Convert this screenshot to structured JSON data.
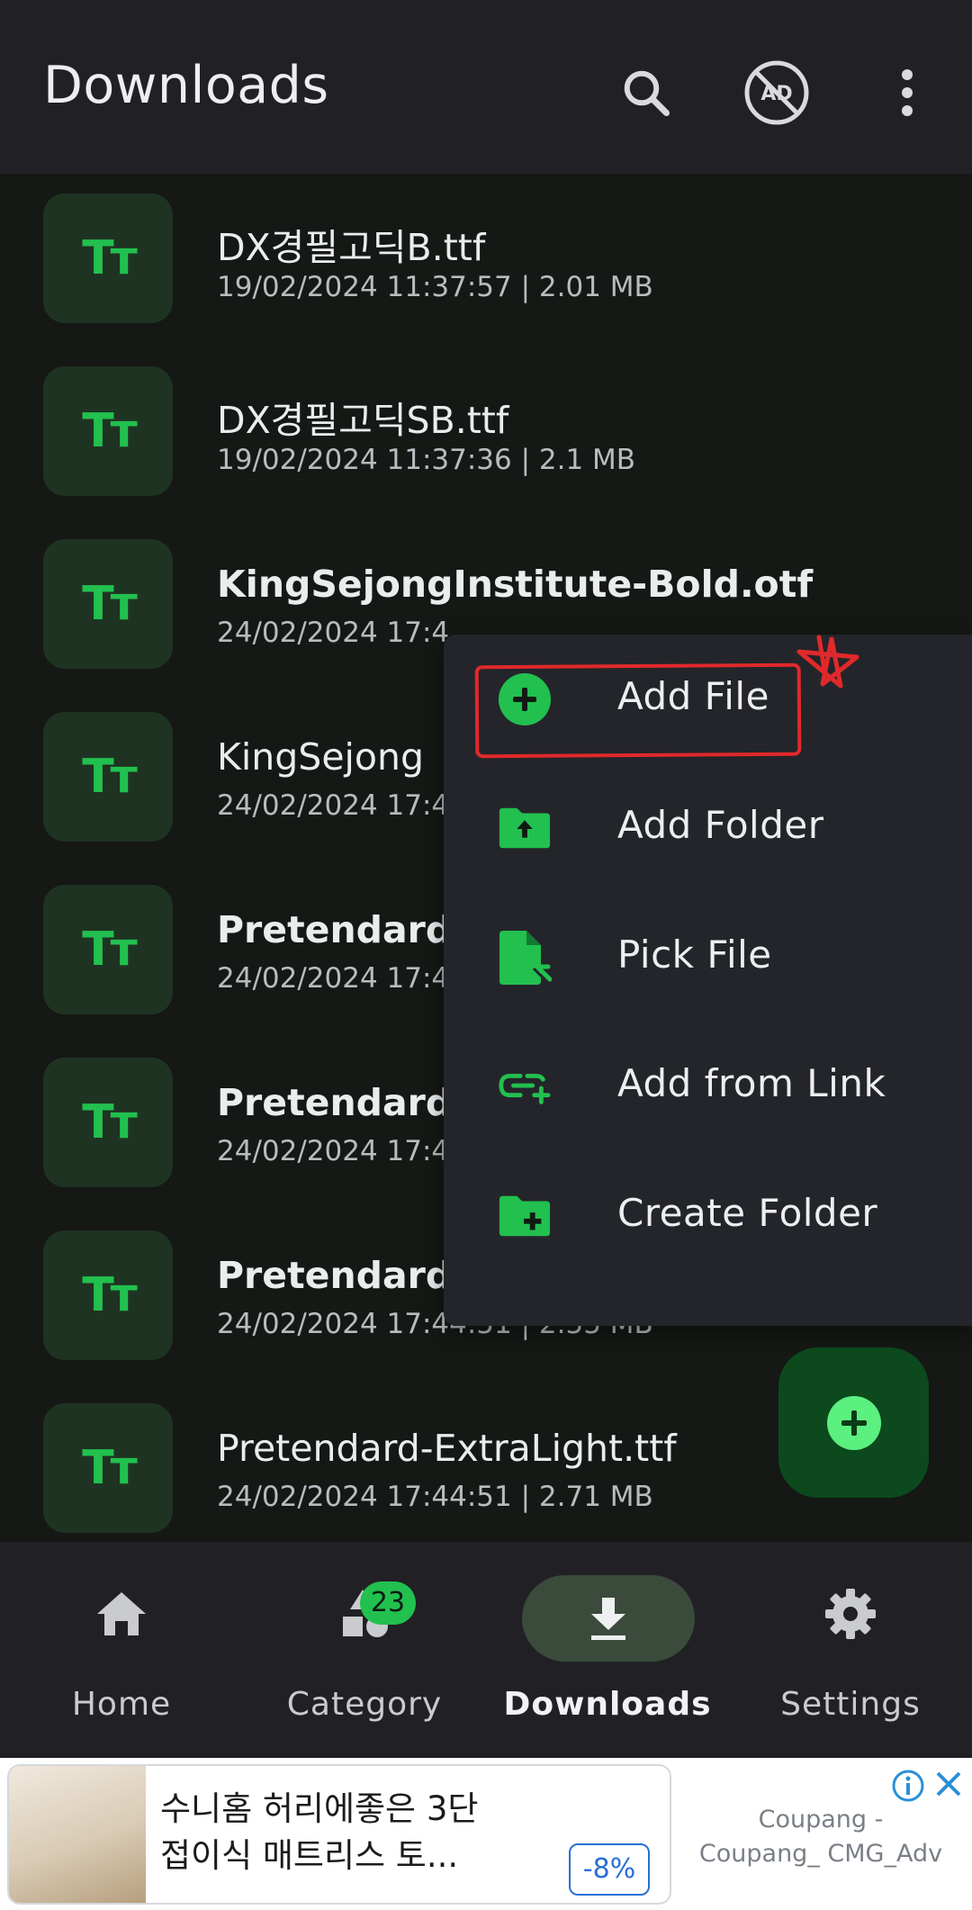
{
  "appbar": {
    "title": "Downloads",
    "icons": [
      "search-icon",
      "ad-free-icon",
      "more-vert-icon"
    ]
  },
  "files": [
    {
      "name": "DX경필고딕B.ttf",
      "meta": "19/02/2024 11:37:57 | 2.01 MB",
      "bold": false,
      "thumb": "Tт"
    },
    {
      "name": "DX경필고딕SB.ttf",
      "meta": "19/02/2024 11:37:36 | 2.1 MB",
      "bold": false,
      "thumb": "Tт"
    },
    {
      "name": "KingSejongInstitute-Bold.otf",
      "meta": "24/02/2024 17:4",
      "bold": true,
      "thumb": "Tт"
    },
    {
      "name": "KingSejong",
      "meta": "24/02/2024 17:4",
      "bold": false,
      "thumb": "Tт"
    },
    {
      "name": "Pretendard-",
      "meta": "24/02/2024 17:4",
      "bold": true,
      "thumb": "Tт"
    },
    {
      "name": "Pretendard-",
      "meta": "24/02/2024 17:4",
      "bold": true,
      "thumb": "Tт"
    },
    {
      "name": "Pretendard-",
      "meta": "24/02/2024 17:44:51 | 2.55 MB",
      "bold": true,
      "thumb": "Tт"
    },
    {
      "name": "Pretendard-ExtraLight.ttf",
      "meta": "24/02/2024 17:44:51 | 2.71 MB",
      "bold": false,
      "thumb": "Tт"
    }
  ],
  "menu": {
    "items": [
      {
        "label": "Add File",
        "icon": "add-circle-icon"
      },
      {
        "label": "Add Folder",
        "icon": "folder-upload-icon"
      },
      {
        "label": "Pick File",
        "icon": "file-pick-icon"
      },
      {
        "label": "Add from Link",
        "icon": "link-add-icon"
      },
      {
        "label": "Create Folder",
        "icon": "folder-add-icon"
      }
    ]
  },
  "fab": {
    "icon": "add-icon"
  },
  "bottom_nav": {
    "items": [
      {
        "label": "Home",
        "icon": "home-icon"
      },
      {
        "label": "Category",
        "icon": "category-icon"
      },
      {
        "label": "Downloads",
        "icon": "download-icon"
      },
      {
        "label": "Settings",
        "icon": "settings-icon"
      }
    ],
    "active": "Downloads",
    "category_badge": "23"
  },
  "ad": {
    "line1": "수니홈 허리에좋은 3단",
    "line2": "접이식 매트리스 토...",
    "discount": "-8%",
    "advertiser": "Coupang - Coupang_ CMG_Adv"
  },
  "colors": {
    "accent": "#22c04f",
    "appbar_bg": "#212125",
    "list_bg": "#151815",
    "thumb_bg": "#1f3322",
    "menu_bg": "#24252a",
    "fab_bg": "#0c4a1d",
    "annotation": "#e1292b"
  }
}
